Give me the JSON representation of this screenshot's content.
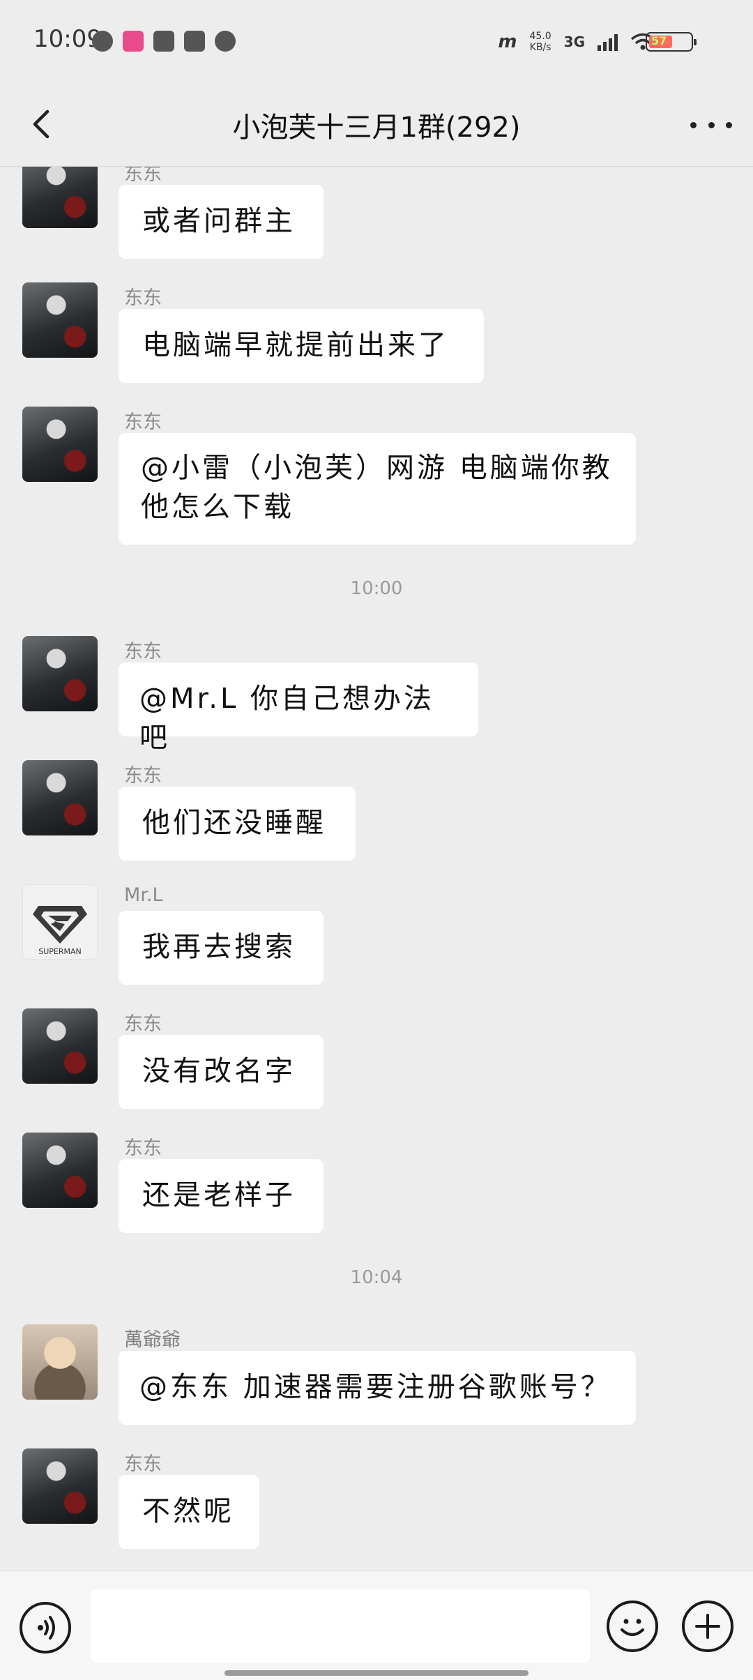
{
  "status_bar": {
    "time": "10:09",
    "network_speed": "45.0\nKB/s",
    "network_type": "3G",
    "battery_level": "57",
    "icons": [
      "globe-icon",
      "bilibili-icon",
      "cat-icon",
      "app-icon",
      "qq-icon"
    ]
  },
  "header": {
    "title": "小泡芙十三月1群(292)"
  },
  "messages": [
    {
      "sender": "东东",
      "text": "或者问群主",
      "avatar": "dark"
    },
    {
      "sender": "东东",
      "text": "电脑端早就提前出来了",
      "avatar": "dark"
    },
    {
      "sender": "东东",
      "text": "@小雷（小泡芙）网游 电脑端你教他怎么下载",
      "avatar": "dark"
    },
    {
      "sender": "东东",
      "text": "@Mr.L 你自己想办法吧",
      "avatar": "dark"
    },
    {
      "sender": "东东",
      "text": "他们还没睡醒",
      "avatar": "dark"
    },
    {
      "sender": "Mr.L",
      "text": "我再去搜索",
      "avatar": "superman"
    },
    {
      "sender": "东东",
      "text": "没有改名字",
      "avatar": "dark"
    },
    {
      "sender": "东东",
      "text": "还是老样子",
      "avatar": "dark"
    },
    {
      "sender": "萬爺爺",
      "text": "@东东 加速器需要注册谷歌账号？",
      "avatar": "cartoon"
    },
    {
      "sender": "东东",
      "text": "不然呢",
      "avatar": "dark"
    }
  ],
  "timestamps": [
    "10:00",
    "10:04"
  ],
  "superman_avatar_text": "SUPERMAN",
  "input": {
    "value": "",
    "placeholder": ""
  },
  "colors": {
    "background": "#ededed",
    "bubble": "#ffffff",
    "sender": "#8b8b8b",
    "timestamp": "#9a9a9a"
  }
}
